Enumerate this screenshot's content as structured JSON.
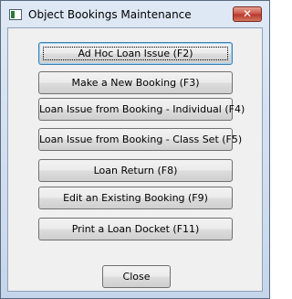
{
  "window": {
    "title": "Object Bookings Maintenance",
    "close_glyph": "✕"
  },
  "buttons": [
    {
      "label": "Ad Hoc Loan Issue (F2)"
    },
    {
      "label": "Make a New Booking (F3)"
    },
    {
      "label": "Loan Issue from Booking - Individual (F4)"
    },
    {
      "label": "Loan Issue from Booking - Class Set (F5)"
    },
    {
      "label": "Loan Return (F8)"
    },
    {
      "label": "Edit an Existing Booking (F9)"
    },
    {
      "label": "Print a Loan Docket (F11)"
    }
  ],
  "close_button": {
    "label": "Close"
  }
}
